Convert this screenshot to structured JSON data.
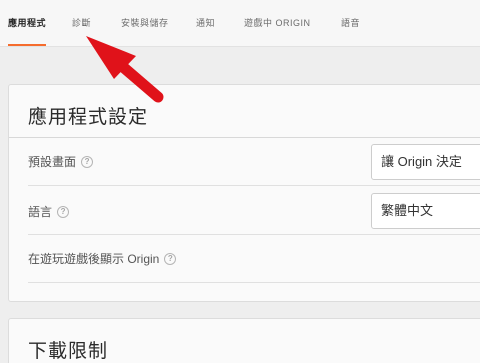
{
  "tabs": [
    {
      "label": "應用程式",
      "active": true
    },
    {
      "label": "診斷",
      "active": false
    },
    {
      "label": "安裝與儲存",
      "active": false
    },
    {
      "label": "通知",
      "active": false
    },
    {
      "label": "遊戲中 ORIGIN",
      "active": false
    },
    {
      "label": "語音",
      "active": false
    }
  ],
  "app_settings": {
    "title": "應用程式設定",
    "rows": [
      {
        "label": "預設畫面",
        "help_icon": "question-circle-icon",
        "value": "讓 Origin 決定"
      },
      {
        "label": "語言",
        "help_icon": "question-circle-icon",
        "value": "繁體中文"
      },
      {
        "label": "在遊玩遊戲後顯示 Origin",
        "help_icon": "question-circle-icon"
      }
    ]
  },
  "download_limits": {
    "title": "下載限制"
  },
  "annotation": {
    "icon": "red-arrow-icon",
    "color": "#e0121a"
  },
  "colors": {
    "accent": "#f56c2d",
    "background": "#eeeeee",
    "panel": "#fafafa"
  }
}
